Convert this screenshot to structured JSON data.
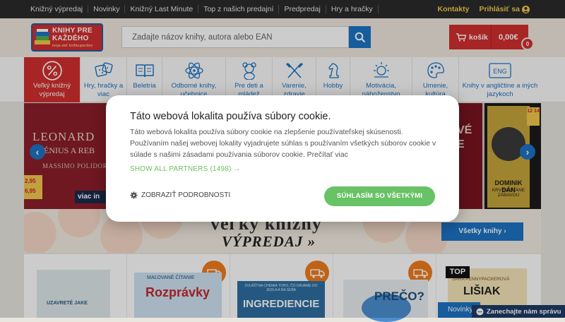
{
  "topnav": {
    "items": [
      "Knižný výpredaj",
      "Novinky",
      "Knižný Last Minute",
      "Top z našich predajní",
      "Predpredaj",
      "Hry a hračky"
    ],
    "kontakty": "Kontakty",
    "login": "Prihlásiť sa"
  },
  "header": {
    "logo_line1": "KNIHY PRE",
    "logo_line2": "KAŽDÉHO",
    "logo_tagline": "tvoja sieť kníhkupectiev",
    "search_placeholder": "Zadajte názov knihy, autora alebo EAN",
    "cart_label": "košík",
    "cart_price": "0,00€",
    "cart_count": "0"
  },
  "categories": [
    {
      "label": "Veľký knižný výpredaj",
      "icon": "percent-icon"
    },
    {
      "label": "Hry, hračky a viac",
      "icon": "dice-icon"
    },
    {
      "label": "Beletria",
      "icon": "open-book-icon"
    },
    {
      "label": "Odborné knihy, učebnice",
      "icon": "atom-icon"
    },
    {
      "label": "Pre deti a mládež",
      "icon": "teddy-bear-icon"
    },
    {
      "label": "Varenie, zdravie",
      "icon": "fork-knife-icon"
    },
    {
      "label": "Hobby",
      "icon": "chess-knight-icon"
    },
    {
      "label": "Motivácia, náboženstvo",
      "icon": "sun-icon"
    },
    {
      "label": "Umenie, kultúra",
      "icon": "palette-icon"
    },
    {
      "label": "Knihy v angličtine a iných jazykoch",
      "icon": "eng-icon"
    }
  ],
  "banner": {
    "left_title": "LEONARD",
    "left_subtitle": "ÉNIUS A REB",
    "left_author": "MASSIMO POLIDORO",
    "left_price_old": "2,95",
    "left_price_new": "6,95",
    "left_more": "viac in",
    "right_title": "VÉ",
    "right_title2": "E",
    "book_author": "DOMINIK DÁN",
    "book_title": "KRV SA STANE ZÁBAVOU",
    "book_badge": "12 14"
  },
  "sale_strip": {
    "line1": "veľký knižný",
    "line2": "VÝPREDAJ »",
    "all_books": "Všetky knihy ›"
  },
  "products": [
    {
      "title": "UZAVRETÉ JAKE"
    },
    {
      "series": "MAĽOVANÉ ČÍTANIE",
      "title": "Rozprávky"
    },
    {
      "series": "ZVLÁŠTNA CHÉMIA TOHO, ČO DÁVAME DO JEDLA A NA SEBA",
      "title": "INGREDIENCIE"
    },
    {
      "title": "PREČO?"
    },
    {
      "series": "SARA PENNYPACKEROVÁ",
      "title": "LIŠIAK"
    }
  ],
  "top_badge": "TOP",
  "novinky": "Novinky",
  "chat": "Zanechajte nám správu",
  "cookie": {
    "title": "Táto webová lokalita používa súbory cookie.",
    "body": "Táto webová lokalita používa súbory cookie na zlepšenie používateľskej skúsenosti. Používaním našej webovej lokality vyjadrujete súhlas s používaním všetkých súborov cookie v súlade s našimi zásadami používania súborov cookie. Prečítať viac",
    "partners": "SHOW ALL PARTNERS (1498) →",
    "details": "ZOBRAZIŤ PODROBNOSTI",
    "accept": "SÚHLASÍM SO VŠETKÝMI"
  },
  "colors": {
    "brand_red": "#d32f2f",
    "brand_blue": "#1d73c3",
    "accept_green": "#68c266",
    "accent_yellow": "#f2c94c"
  }
}
